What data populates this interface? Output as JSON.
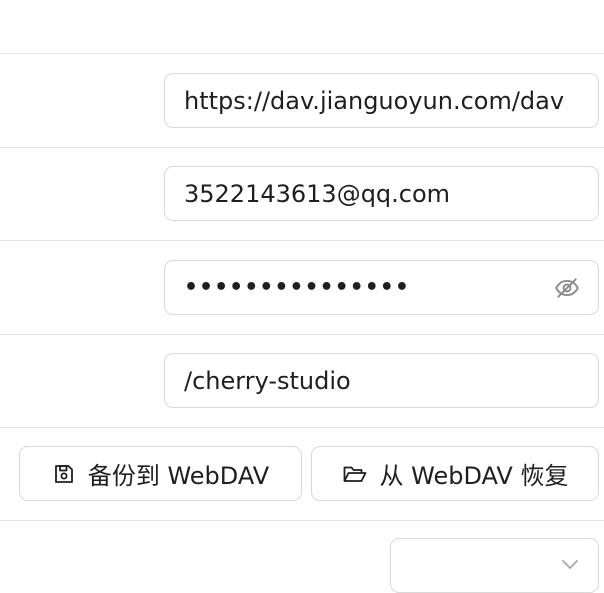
{
  "webdav": {
    "host": {
      "value": "https://dav.jianguoyun.com/dav"
    },
    "user": {
      "value": "3522143613@qq.com"
    },
    "password": {
      "masked_value": "•••••••••••••••",
      "toggle_icon": "eye-off-icon"
    },
    "path": {
      "value": "/cherry-studio"
    },
    "backup_button": {
      "label": "备份到 WebDAV",
      "icon": "save-icon"
    },
    "restore_button": {
      "label": "从 WebDAV 恢复",
      "icon": "folder-open-icon"
    },
    "sync_select": {
      "icon": "chevron-down-icon"
    }
  },
  "colors": {
    "border": "#d9d9d9",
    "divider": "#e4e4e4",
    "text": "#1f1f1f",
    "icon": "#8c8c8c"
  }
}
